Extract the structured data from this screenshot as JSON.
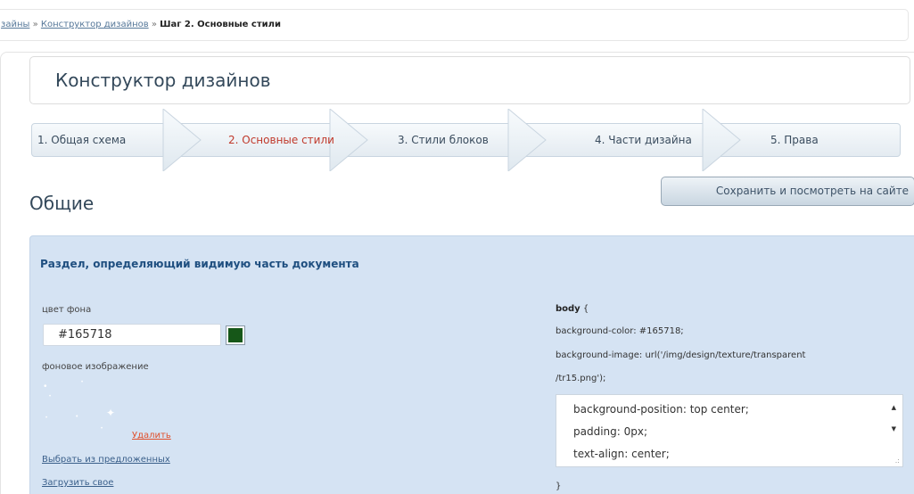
{
  "breadcrumb": {
    "item1": "зайны",
    "sep1": " » ",
    "item2": "Конструктор дизайнов",
    "sep2": " » ",
    "current": "Шаг 2. Основные стили"
  },
  "page_title": "Конструктор дизайнов",
  "steps": [
    {
      "label": "1. Общая схема",
      "active": false
    },
    {
      "label": "2. Основные стили",
      "active": true
    },
    {
      "label": "3. Стили блоков",
      "active": false
    },
    {
      "label": "4. Части дизайна",
      "active": false
    },
    {
      "label": "5. Права",
      "active": false
    }
  ],
  "save_button": "Сохранить и посмотреть на сайте",
  "section_title": "Общие",
  "panel": {
    "heading": "Раздел, определяющий видимую часть документа",
    "bg_color_label": "цвет фона",
    "bg_color_value": "#165718",
    "bg_color_swatch": "#165718",
    "bg_image_label": "фоновое изображение",
    "delete_link": "Удалить",
    "choose_link": "Выбрать из предложенных",
    "upload_link": "Загрузить свое"
  },
  "css_preview": {
    "selector": "body",
    "open_brace": " {",
    "line1": "background-color: #165718;",
    "line2": "background-image: url('/img/design/texture/transparent",
    "line3": "/tr15.png');",
    "extra_lines": [
      "background-position: top center;",
      "padding: 0px;",
      "text-align: center;"
    ],
    "close_brace": "}"
  }
}
